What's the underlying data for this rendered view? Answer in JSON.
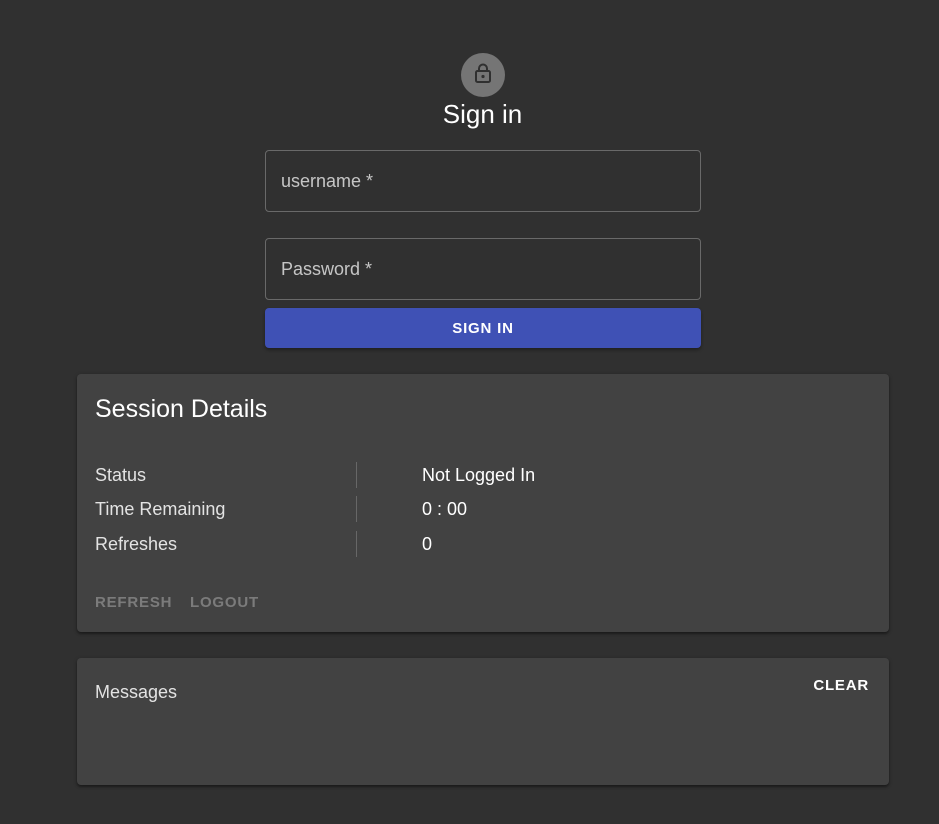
{
  "signin": {
    "icon": "lock-icon",
    "title": "Sign in",
    "username_label": "username *",
    "username_value": "",
    "password_label": "Password *",
    "password_value": "",
    "button_label": "SIGN IN",
    "button_color": "#3f51b5"
  },
  "session": {
    "title": "Session Details",
    "rows": [
      {
        "label": "Status",
        "value": "Not Logged In"
      },
      {
        "label": "Time Remaining",
        "value": "0 : 00"
      },
      {
        "label": "Refreshes",
        "value": "0"
      }
    ],
    "refresh_label": "REFRESH",
    "logout_label": "LOGOUT"
  },
  "messages": {
    "title": "Messages",
    "clear_label": "CLEAR"
  }
}
